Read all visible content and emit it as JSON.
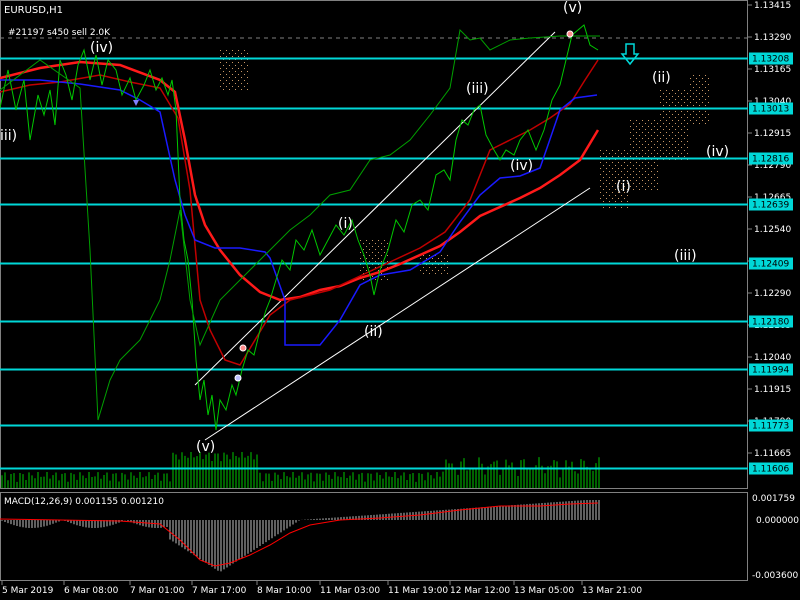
{
  "window": {
    "symbol_title": "EURUSD,H1",
    "trade_label": "#21197 s450 sell 2.0K"
  },
  "colors": {
    "background": "#000000",
    "price_line": "#00c800",
    "hline": "#00d8d8",
    "ma_red": "#ff1a1a",
    "ma_dark_red": "#c00000",
    "ma_blue": "#1a1aff",
    "channel": "#ffffff",
    "cloud": "#c89664",
    "volume": "#00c800",
    "macd_hist": "#c0c0c0",
    "macd_signal": "#ff0000",
    "axis_text": "#ffffff",
    "level_label_bg": "#00d8d8",
    "level_label_text": "#000000"
  },
  "price_axis": {
    "labels": [
      "1.13415",
      "1.13290",
      "1.13165",
      "1.13040",
      "1.12915",
      "1.12790",
      "1.12665",
      "1.12540",
      "1.12415",
      "1.12290",
      "1.12165",
      "1.12040",
      "1.11915",
      "1.11790",
      "1.11665"
    ]
  },
  "levels": [
    "1.13208",
    "1.13013",
    "1.12816",
    "1.12639",
    "1.12409",
    "1.12180",
    "1.11994",
    "1.11773",
    "1.11606"
  ],
  "wave_labels": {
    "upper_iv": "(iv)",
    "left_iii": "iii)",
    "lower_v": "(v)",
    "wave_i": "(i)",
    "wave_ii": "(ii)",
    "wave_iii": "(iii)",
    "wave_iv_mid": "(iv)",
    "top_v": "(v)",
    "proj_ii": "(ii)",
    "proj_iv": "(iv)",
    "proj_i": "(i)",
    "proj_iii": "(iii)"
  },
  "projection_arrow": "down-arrow-icon",
  "macd": {
    "label": "MACD(12,26,9) 0.001155 0.001210",
    "axis": [
      "0.001759",
      "0.000000",
      "-0.003600"
    ]
  },
  "time_axis": {
    "labels": [
      "5 Mar 2019",
      "6 Mar 08:00",
      "7 Mar 01:00",
      "7 Mar 17:00",
      "8 Mar 10:00",
      "11 Mar 03:00",
      "11 Mar 19:00",
      "12 Mar 12:00",
      "13 Mar 05:00",
      "13 Mar 21:00"
    ]
  }
}
